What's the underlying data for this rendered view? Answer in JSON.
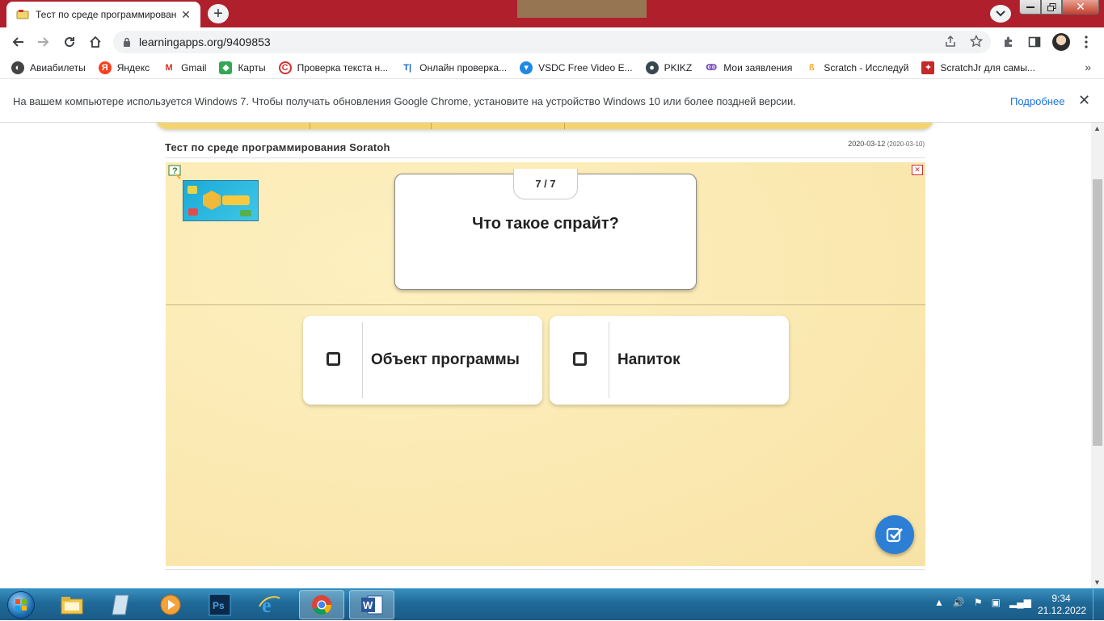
{
  "browser": {
    "tab_title": "Тест по среде программирован",
    "url": "learningapps.org/9409853",
    "bookmarks": [
      {
        "label": "Авиабилеты",
        "icon": "globe-icon"
      },
      {
        "label": "Яндекс",
        "icon": "yandex-icon"
      },
      {
        "label": "Gmail",
        "icon": "gmail-icon"
      },
      {
        "label": "Карты",
        "icon": "maps-icon"
      },
      {
        "label": "Проверка текста н...",
        "icon": "text-check-icon"
      },
      {
        "label": "Онлайн проверка...",
        "icon": "online-check-icon"
      },
      {
        "label": "VSDC Free Video E...",
        "icon": "vsdc-icon"
      },
      {
        "label": "PKIKZ",
        "icon": "pkikz-icon"
      },
      {
        "label": "Мои заявления",
        "icon": "applications-icon"
      },
      {
        "label": "Scratch - Исследуй",
        "icon": "scratch-icon"
      },
      {
        "label": "ScratchJr для самы...",
        "icon": "scratchjr-icon"
      }
    ],
    "infobar": {
      "message": "На вашем компьютере используется Windows 7. Чтобы получать обновления Google Chrome, установите на устройство Windows 10 или более поздней версии.",
      "link": "Подробнее"
    }
  },
  "app": {
    "title": "Тест по среде программирования Soratoh",
    "date": "2020-03-12",
    "date_sub": "(2020-03-10)",
    "counter": "7 / 7",
    "question": "Что такое спрайт?",
    "answers": [
      {
        "label": "Объект программы"
      },
      {
        "label": "Напиток"
      }
    ]
  },
  "taskbar": {
    "time": "9:34",
    "date": "21.12.2022",
    "apps": [
      "explorer",
      "notepad",
      "media",
      "photoshop",
      "internet-explorer",
      "chrome",
      "word"
    ]
  },
  "colors": {
    "tabstrip": "#b0202c",
    "stage": "#fbe9b2",
    "menu_band": "#f4d56d",
    "check_button": "#2c7fd4",
    "link": "#1a73e8"
  }
}
